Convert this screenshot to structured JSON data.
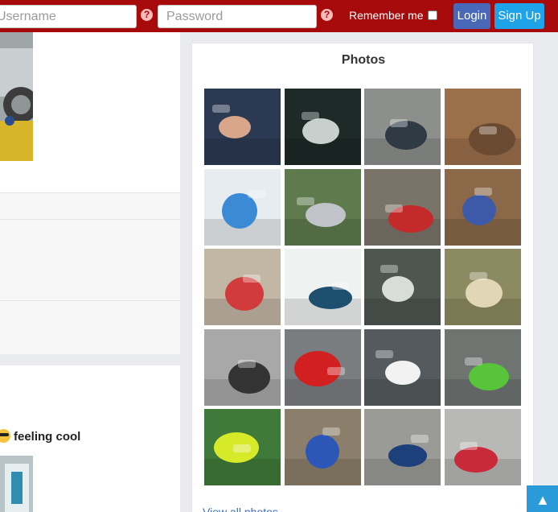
{
  "header": {
    "username_placeholder": "Username",
    "password_placeholder": "Password",
    "remember_label": "Remember me",
    "login_label": "Login",
    "signup_label": "Sign Up",
    "help_glyph": "?"
  },
  "feed": {
    "status_text": "feeling cool"
  },
  "photos": {
    "title": "Photos",
    "view_all": "View all photos",
    "tiles": [
      {
        "subject": "driver-portrait-redbull-cap",
        "bg": "#2b3a52",
        "fg": "#d8a68a"
      },
      {
        "subject": "driver-in-helmet-petronas",
        "bg": "#1d2a27",
        "fg": "#c7d0cd"
      },
      {
        "subject": "rally-driver-with-car",
        "bg": "#8d8f8c",
        "fg": "#2f3a44"
      },
      {
        "subject": "dirt-bike-desert",
        "bg": "#9a6f4a",
        "fg": "#6a4a30"
      },
      {
        "subject": "f1-car-top-view",
        "bg": "#e7ecf0",
        "fg": "#3a8ad6"
      },
      {
        "subject": "race-start-track",
        "bg": "#5f7a4d",
        "fg": "#c0c4c8"
      },
      {
        "subject": "rally-car-crash",
        "bg": "#7a7368",
        "fg": "#c42a2a"
      },
      {
        "subject": "rally-car-canyon",
        "bg": "#8a6848",
        "fg": "#3d5aa8"
      },
      {
        "subject": "rally-car-dust",
        "bg": "#c2b6a4",
        "fg": "#d23b3b"
      },
      {
        "subject": "speedway-poster-zohor",
        "bg": "#eef2f0",
        "fg": "#1e4f6e"
      },
      {
        "subject": "speedway-riders-bw",
        "bg": "#4e5650",
        "fg": "#d9ddd9"
      },
      {
        "subject": "men-on-track-sideline",
        "bg": "#8c8a60",
        "fg": "#e1d7b6"
      },
      {
        "subject": "speedway-rider-bw",
        "bg": "#a8a8a8",
        "fg": "#333333"
      },
      {
        "subject": "motogp-rider",
        "bg": "#7a7d80",
        "fg": "#d22020"
      },
      {
        "subject": "white-sports-car",
        "bg": "#555a5e",
        "fg": "#f2f2f2"
      },
      {
        "subject": "green-race-car",
        "bg": "#6f7471",
        "fg": "#58c43a"
      },
      {
        "subject": "yellow-lamborghini",
        "bg": "#3f7a3a",
        "fg": "#d6ea2a"
      },
      {
        "subject": "ford-gt-race",
        "bg": "#8b7e6a",
        "fg": "#2d57b7"
      },
      {
        "subject": "prototype-race-cars",
        "bg": "#9a9a96",
        "fg": "#1d3f7a"
      },
      {
        "subject": "red-prototype-cars",
        "bg": "#b8b8b6",
        "fg": "#c82a3a"
      }
    ]
  },
  "ui": {
    "scroll_top_glyph": "▲"
  }
}
